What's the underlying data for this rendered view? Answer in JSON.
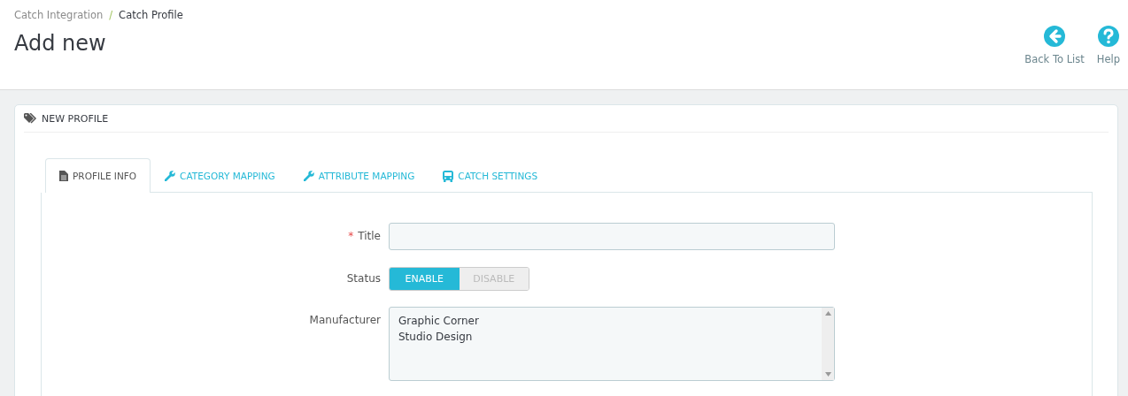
{
  "breadcrumb": [
    {
      "label": "Catch Integration"
    },
    {
      "label": "Catch Profile"
    }
  ],
  "breadcrumb_separator": "/",
  "page_title": "Add new",
  "toolbar": [
    {
      "label": "Back To List"
    },
    {
      "label": "Help"
    }
  ],
  "panel": {
    "heading": "NEW PROFILE"
  },
  "tabs": [
    {
      "label": "PROFILE INFO",
      "selected": true
    },
    {
      "label": "CATEGORY MAPPING",
      "selected": false
    },
    {
      "label": "ATTRIBUTE MAPPING",
      "selected": false
    },
    {
      "label": "CATCH SETTINGS",
      "selected": false
    }
  ],
  "form": {
    "title": {
      "label": "Title",
      "required_mark": "*"
    },
    "status": {
      "label": "Status",
      "options": [
        {
          "label": "ENABLE",
          "selected": true
        },
        {
          "label": "DISABLE",
          "selected": false
        }
      ]
    },
    "manufacturer": {
      "label": "Manufacturer",
      "items": [
        {
          "label": "Graphic Corner",
          "selected": false
        },
        {
          "label": "Studio Design",
          "selected": false
        }
      ]
    }
  }
}
